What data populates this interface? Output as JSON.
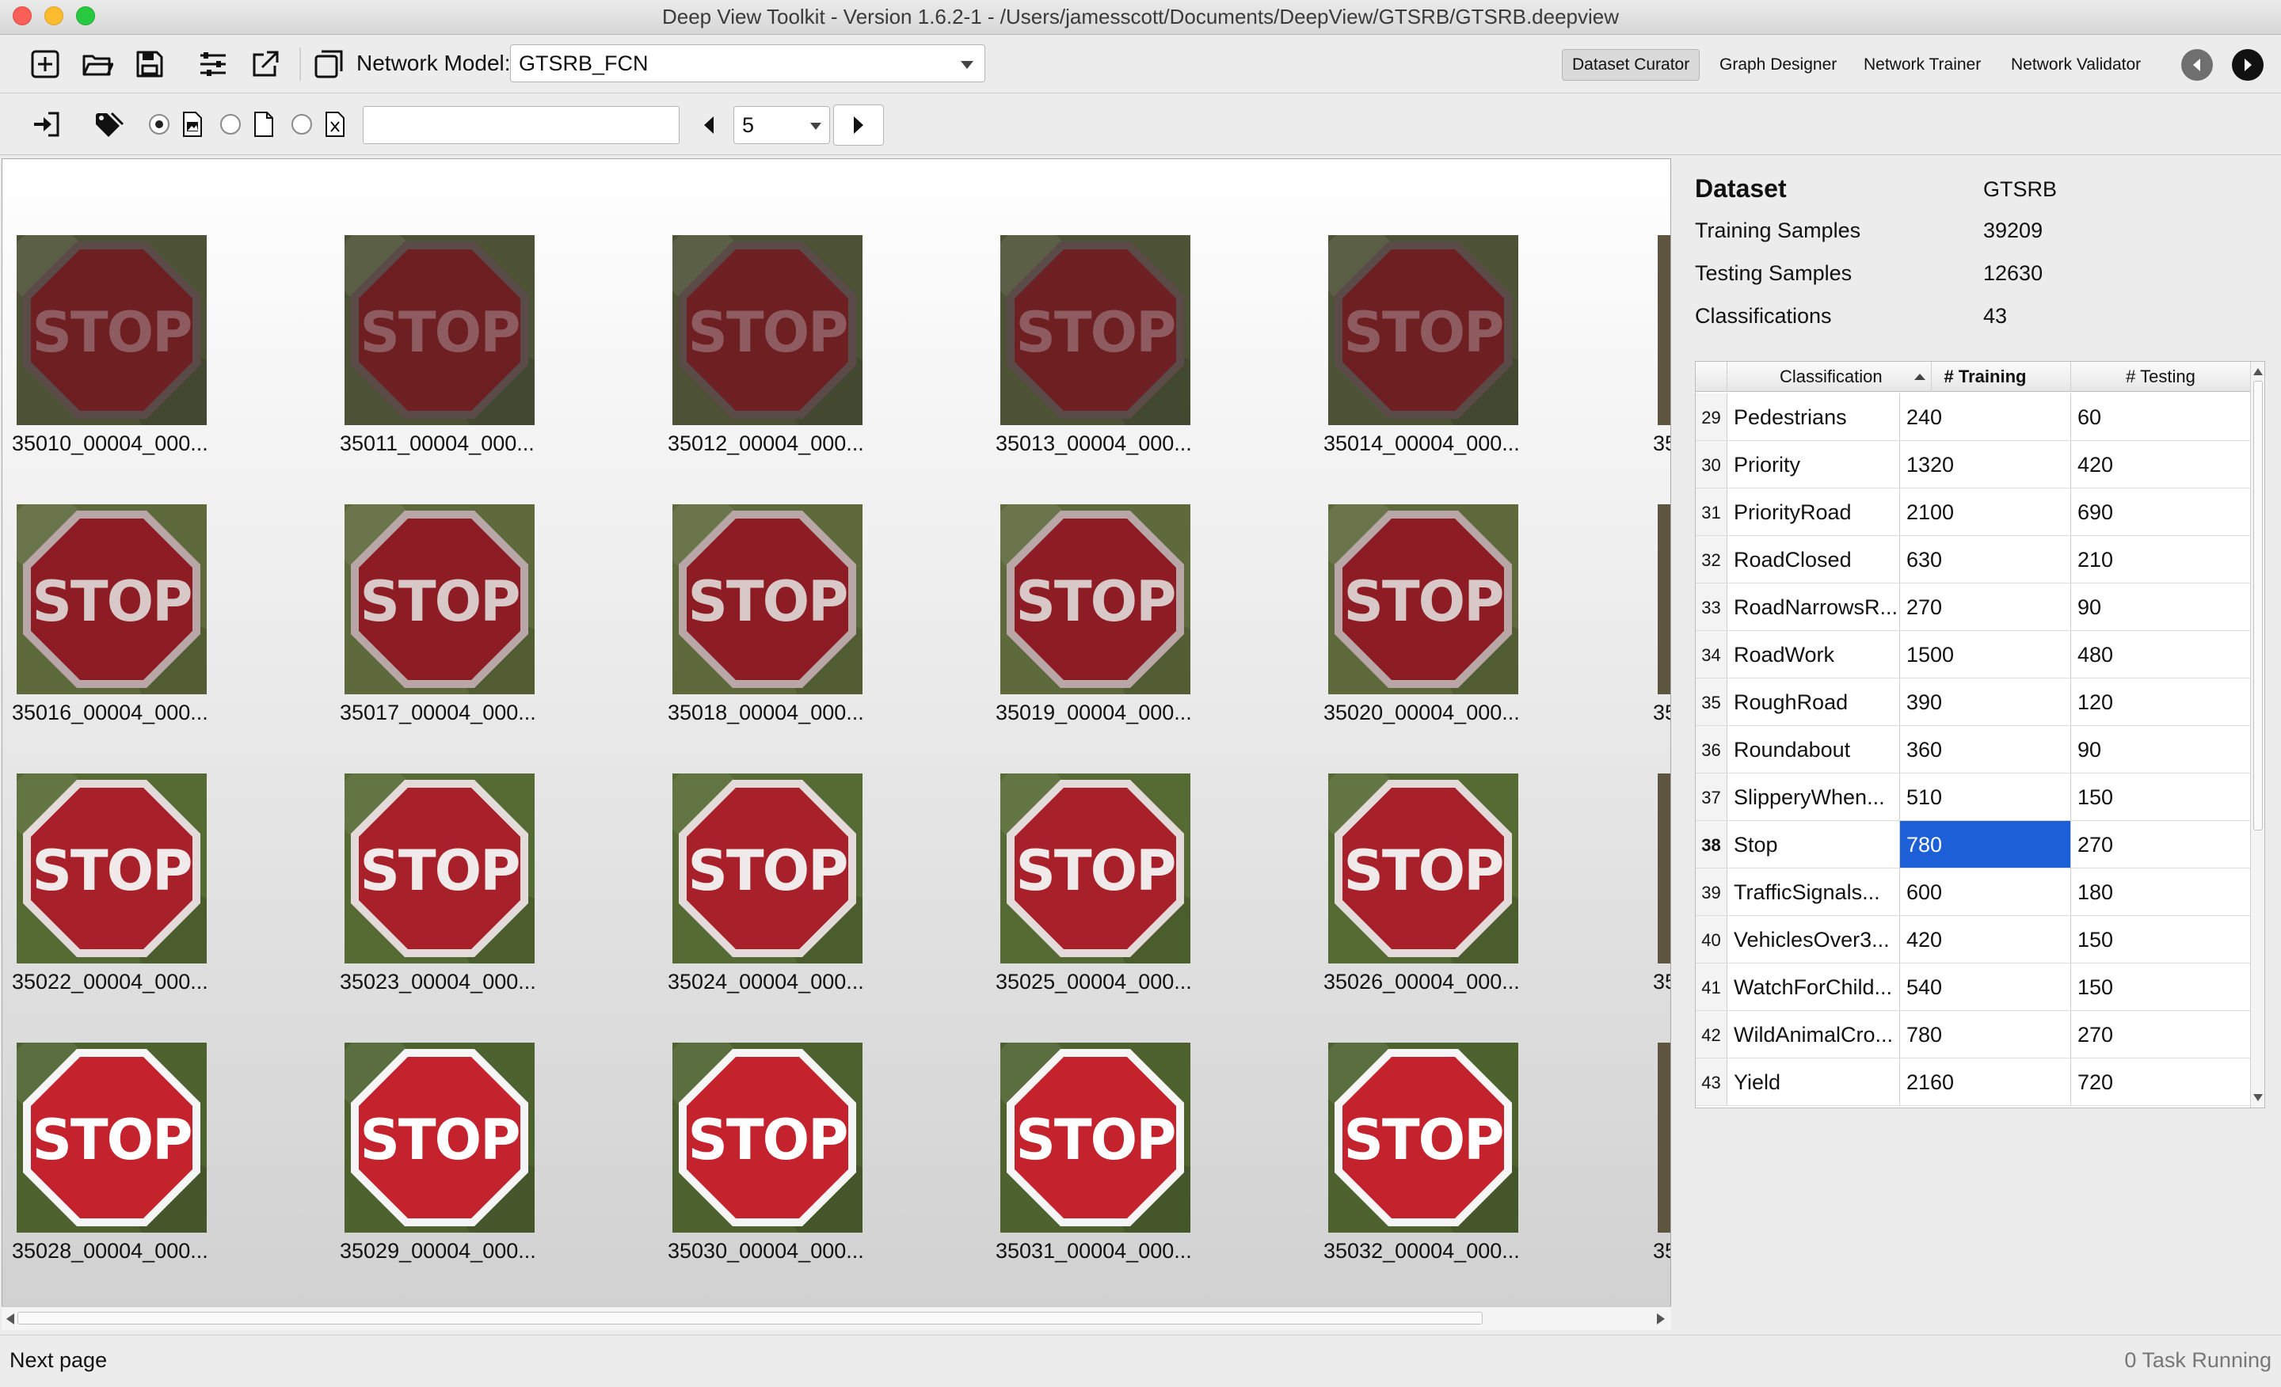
{
  "window": {
    "title": "Deep View Toolkit  -  Version 1.6.2-1 - /Users/jamesscott/Documents/DeepView/GTSRB/GTSRB.deepview"
  },
  "toolbar": {
    "icons": [
      "new-icon",
      "open-folder-icon",
      "save-icon",
      "settings-sliders-icon",
      "export-icon",
      "copy-window-icon"
    ],
    "network_model_label": "Network Model:",
    "network_model_value": "GTSRB_FCN",
    "mode_tabs": [
      "Dataset Curator",
      "Graph Designer",
      "Network Trainer",
      "Network Validator"
    ],
    "active_tab": "Dataset Curator"
  },
  "filter_bar": {
    "icons": [
      "import-icon",
      "tags-icon"
    ],
    "radio_options": [
      "image-file-icon",
      "blank-file-icon",
      "spreadsheet-file-icon"
    ],
    "selected_radio": 0,
    "search_value": "",
    "page_value": "5"
  },
  "grid": {
    "images": [
      {
        "label": "35010_00004_000...",
        "variant": "dark"
      },
      {
        "label": "35011_00004_000...",
        "variant": "dark"
      },
      {
        "label": "35012_00004_000...",
        "variant": "dark"
      },
      {
        "label": "35013_00004_000...",
        "variant": "dark"
      },
      {
        "label": "35014_00004_000...",
        "variant": "dark"
      },
      {
        "label": "35016_00004_000...",
        "variant": "mid"
      },
      {
        "label": "35017_00004_000...",
        "variant": "mid"
      },
      {
        "label": "35018_00004_000...",
        "variant": "mid"
      },
      {
        "label": "35019_00004_000...",
        "variant": "mid"
      },
      {
        "label": "35020_00004_000...",
        "variant": "mid"
      },
      {
        "label": "35022_00004_000...",
        "variant": "bright"
      },
      {
        "label": "35023_00004_000...",
        "variant": "bright"
      },
      {
        "label": "35024_00004_000...",
        "variant": "bright"
      },
      {
        "label": "35025_00004_000...",
        "variant": "bright"
      },
      {
        "label": "35026_00004_000...",
        "variant": "bright"
      },
      {
        "label": "35028_00004_000...",
        "variant": "vivid"
      },
      {
        "label": "35029_00004_000...",
        "variant": "vivid"
      },
      {
        "label": "35030_00004_000...",
        "variant": "vivid"
      },
      {
        "label": "35031_00004_000...",
        "variant": "vivid"
      },
      {
        "label": "35032_00004_000...",
        "variant": "vivid"
      }
    ],
    "partial_column_labels": [
      "35",
      "35",
      "35",
      "35"
    ],
    "sign_text": "STOP"
  },
  "info": {
    "dataset_label": "Dataset",
    "dataset_value": "GTSRB",
    "training_label": "Training Samples",
    "training_value": "39209",
    "testing_label": "Testing Samples",
    "testing_value": "12630",
    "classifications_label": "Classifications",
    "classifications_value": "43"
  },
  "table": {
    "headers": [
      "Classification",
      "# Training",
      "# Testing"
    ],
    "rows": [
      {
        "num": "29",
        "name": "Pedestrians",
        "training": "240",
        "testing": "60"
      },
      {
        "num": "30",
        "name": "Priority",
        "training": "1320",
        "testing": "420"
      },
      {
        "num": "31",
        "name": "PriorityRoad",
        "training": "2100",
        "testing": "690"
      },
      {
        "num": "32",
        "name": "RoadClosed",
        "training": "630",
        "testing": "210"
      },
      {
        "num": "33",
        "name": "RoadNarrowsR...",
        "training": "270",
        "testing": "90"
      },
      {
        "num": "34",
        "name": "RoadWork",
        "training": "1500",
        "testing": "480"
      },
      {
        "num": "35",
        "name": "RoughRoad",
        "training": "390",
        "testing": "120"
      },
      {
        "num": "36",
        "name": "Roundabout",
        "training": "360",
        "testing": "90"
      },
      {
        "num": "37",
        "name": "SlipperyWhen...",
        "training": "510",
        "testing": "150"
      },
      {
        "num": "38",
        "name": "Stop",
        "training": "780",
        "testing": "270"
      },
      {
        "num": "39",
        "name": "TrafficSignals...",
        "training": "600",
        "testing": "180"
      },
      {
        "num": "40",
        "name": "VehiclesOver3...",
        "training": "420",
        "testing": "150"
      },
      {
        "num": "41",
        "name": "WatchForChild...",
        "training": "540",
        "testing": "150"
      },
      {
        "num": "42",
        "name": "WildAnimalCro...",
        "training": "780",
        "testing": "270"
      },
      {
        "num": "43",
        "name": "Yield",
        "training": "2160",
        "testing": "720"
      }
    ],
    "selected_row": "38",
    "selection_color": "#1c5fd6"
  },
  "status": {
    "left": "Next page",
    "right": "0 Task Running"
  }
}
